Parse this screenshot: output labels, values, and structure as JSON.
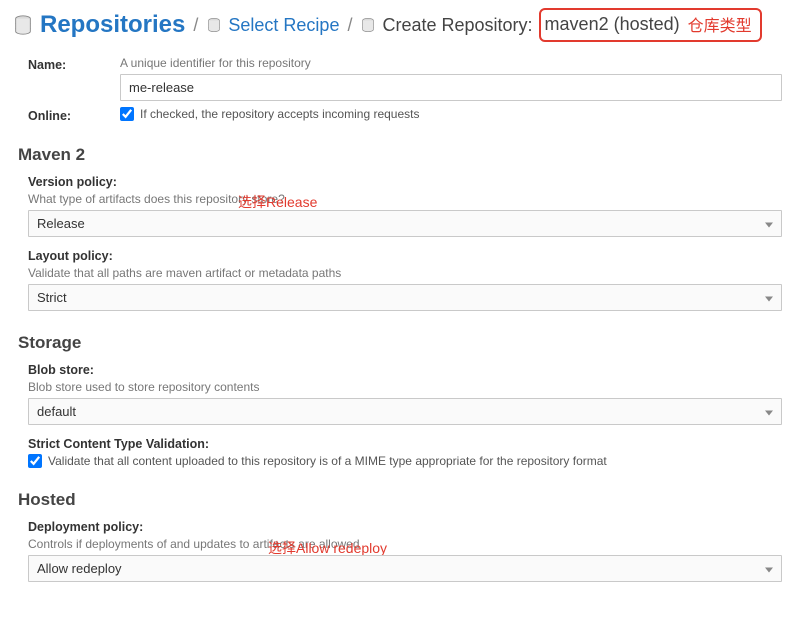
{
  "breadcrumb": {
    "root": "Repositories",
    "step2": "Select Recipe",
    "step3_prefix": "Create Repository:",
    "step3_recipe": "maven2 (hosted)",
    "annot": "仓库类型"
  },
  "name": {
    "label": "Name:",
    "hint": "A unique identifier for this repository",
    "value": "me-release"
  },
  "online": {
    "label": "Online:",
    "hint": "If checked, the repository accepts incoming requests"
  },
  "maven2": {
    "section": "Maven 2",
    "version_label": "Version policy:",
    "version_hint": "What type of artifacts does this repository store?",
    "version_annot": "选择Release",
    "version_value": "Release",
    "layout_label": "Layout policy:",
    "layout_hint": "Validate that all paths are maven artifact or metadata paths",
    "layout_value": "Strict"
  },
  "storage": {
    "section": "Storage",
    "blob_label": "Blob store:",
    "blob_hint": "Blob store used to store repository contents",
    "blob_value": "default",
    "strict_label": "Strict Content Type Validation:",
    "strict_hint": "Validate that all content uploaded to this repository is of a MIME type appropriate for the repository format"
  },
  "hosted": {
    "section": "Hosted",
    "deploy_label": "Deployment policy:",
    "deploy_hint": "Controls if deployments of and updates to artifacts are allowed",
    "deploy_annot": "选择Allow redeploy",
    "deploy_value": "Allow redeploy"
  }
}
